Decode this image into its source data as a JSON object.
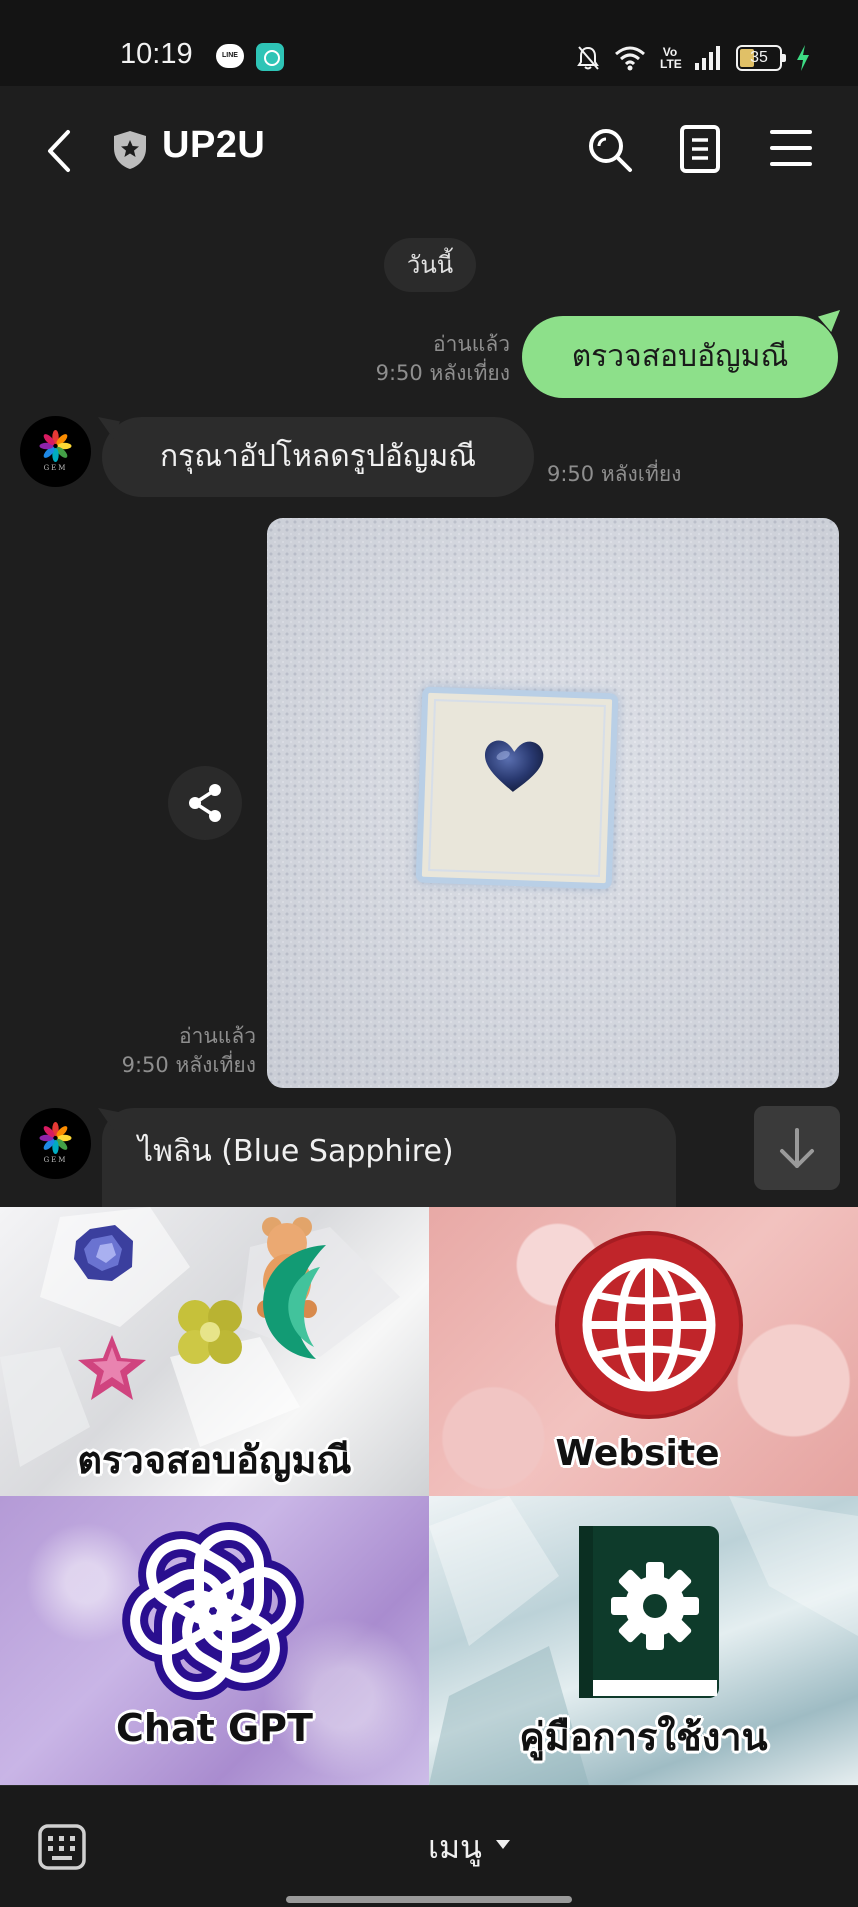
{
  "status_bar": {
    "time": "10:19",
    "line_badge": "LINE",
    "volte": "Vo\nLTE",
    "battery": "35"
  },
  "header": {
    "title": "UP2U"
  },
  "chat": {
    "date_chip": "วันนี้",
    "messages": [
      {
        "from": "me",
        "text": "ตรวจสอบอัญมณี",
        "read": "อ่านแล้ว",
        "time": "9:50 หลังเที่ยง"
      },
      {
        "from": "bot",
        "text": "กรุณาอัปโหลดรูปอัญมณี",
        "time": "9:50 หลังเที่ยง"
      },
      {
        "from": "me",
        "type": "image",
        "read": "อ่านแล้ว",
        "time": "9:50 หลังเที่ยง"
      },
      {
        "from": "bot",
        "text": "ไพลิน (Blue Sapphire)"
      }
    ],
    "avatar_text": "GEM"
  },
  "rich_menu": {
    "tiles": [
      {
        "label": "ตรวจสอบอัญมณี"
      },
      {
        "label": "Website"
      },
      {
        "label": "Chat GPT"
      },
      {
        "label": "คู่มือการใช้งาน"
      }
    ]
  },
  "bottom_bar": {
    "menu_label": "เมนู"
  },
  "colors": {
    "accent_green": "#8de08a",
    "background": "#1e1e1e",
    "bubble_in": "#2c2c2c"
  }
}
